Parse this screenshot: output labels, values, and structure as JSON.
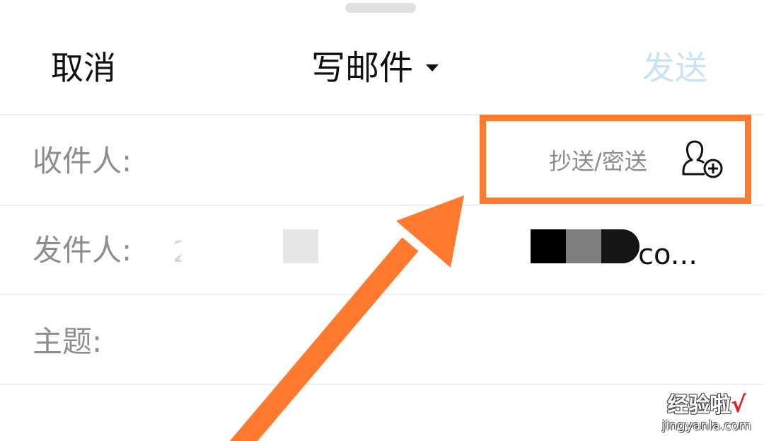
{
  "nav": {
    "cancel_label": "取消",
    "title": "写邮件",
    "send_label": "发送",
    "send_color": "#c9e3f6"
  },
  "fields": {
    "to_label": "收件人:",
    "cc_bcc_label": "抄送/密送",
    "add_contact_icon": "add-contact-icon",
    "from_label": "发件人:",
    "from_value_prefix": "2",
    "from_value_suffix": "co...",
    "subject_label": "主题:"
  },
  "annotation": {
    "highlight_color": "#ff7a2e"
  },
  "watermark": {
    "text": "经验啦",
    "check": "√",
    "url": "jingyanla.com"
  }
}
